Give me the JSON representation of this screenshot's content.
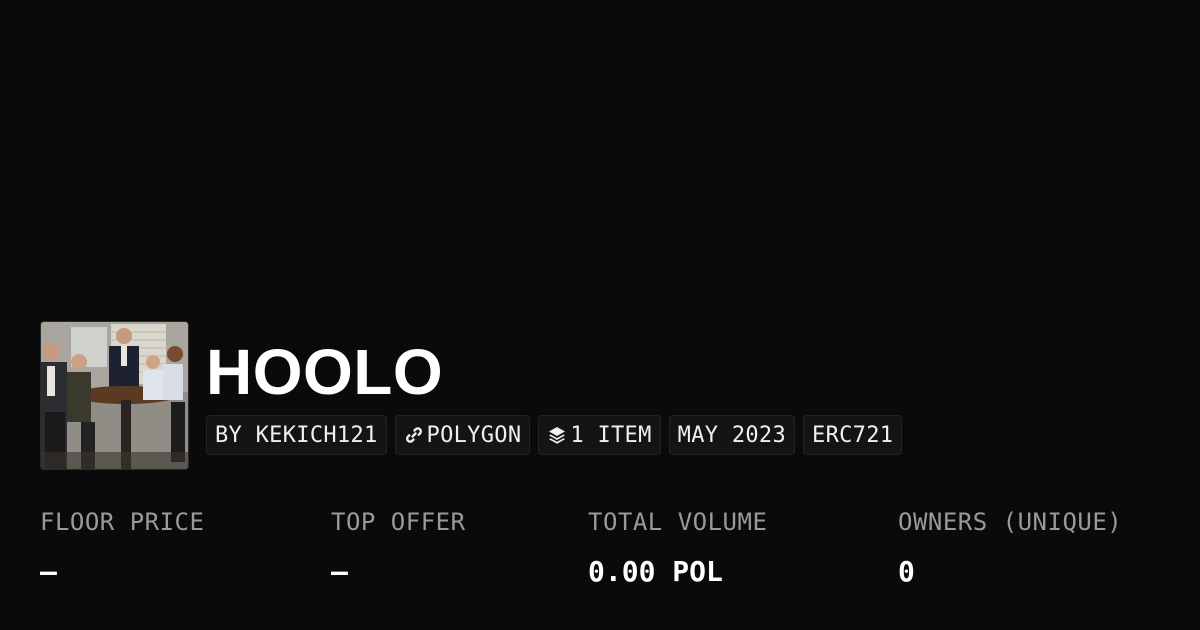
{
  "collection": {
    "name": "HOOLO",
    "thumbnail_alt": "collection-image"
  },
  "tags": {
    "creator": "BY KEKICH121",
    "chain": "POLYGON",
    "chain_icon": "link-icon",
    "items": "1 ITEM",
    "items_icon": "layers-icon",
    "date": "MAY 2023",
    "standard": "ERC721"
  },
  "stats": {
    "floor_price": {
      "label": "FLOOR PRICE",
      "value": "–"
    },
    "top_offer": {
      "label": "TOP OFFER",
      "value": "–"
    },
    "total_volume": {
      "label": "TOTAL VOLUME",
      "value": "0.00 POL"
    },
    "owners": {
      "label": "OWNERS (UNIQUE)",
      "value": "0"
    }
  },
  "colors": {
    "background": "#0a0a0a",
    "text": "#ffffff",
    "muted": "#9a9a9a",
    "tag_bg": "#141414"
  }
}
